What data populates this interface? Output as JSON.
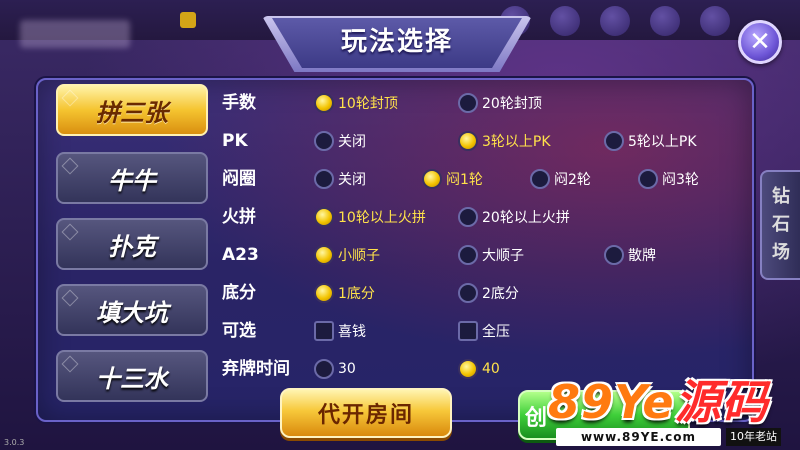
{
  "dialog": {
    "title": "玩法选择",
    "close_icon": "close-x-icon"
  },
  "version": "3.0.3",
  "tabs": [
    {
      "label": "拼三张",
      "active": true
    },
    {
      "label": "牛牛",
      "active": false
    },
    {
      "label": "扑克",
      "active": false
    },
    {
      "label": "填大坑",
      "active": false
    },
    {
      "label": "十三水",
      "active": false
    }
  ],
  "side_tab": {
    "label": "钻石场"
  },
  "rows": [
    {
      "label": "手数",
      "type": "radio",
      "options": [
        {
          "label": "10轮封顶",
          "selected": true
        },
        {
          "label": "20轮封顶",
          "selected": false
        }
      ]
    },
    {
      "label": "PK",
      "type": "radio",
      "options": [
        {
          "label": "关闭",
          "selected": false
        },
        {
          "label": "3轮以上PK",
          "selected": true
        },
        {
          "label": "5轮以上PK",
          "selected": false
        }
      ]
    },
    {
      "label": "闷圈",
      "type": "radio",
      "options": [
        {
          "label": "关闭",
          "selected": false
        },
        {
          "label": "闷1轮",
          "selected": true
        },
        {
          "label": "闷2轮",
          "selected": false
        },
        {
          "label": "闷3轮",
          "selected": false
        }
      ]
    },
    {
      "label": "火拼",
      "type": "radio",
      "options": [
        {
          "label": "10轮以上火拼",
          "selected": true
        },
        {
          "label": "20轮以上火拼",
          "selected": false
        }
      ]
    },
    {
      "label": "A23",
      "type": "radio",
      "options": [
        {
          "label": "小顺子",
          "selected": true
        },
        {
          "label": "大顺子",
          "selected": false
        },
        {
          "label": "散牌",
          "selected": false
        }
      ]
    },
    {
      "label": "底分",
      "type": "radio",
      "options": [
        {
          "label": "1底分",
          "selected": true
        },
        {
          "label": "2底分",
          "selected": false
        }
      ]
    },
    {
      "label": "可选",
      "type": "checkbox",
      "options": [
        {
          "label": "喜钱",
          "selected": false
        },
        {
          "label": "全压",
          "selected": false
        }
      ]
    },
    {
      "label": "弃牌时间",
      "type": "radio",
      "options": [
        {
          "label": "30",
          "selected": false
        },
        {
          "label": "40",
          "selected": true
        }
      ]
    }
  ],
  "buttons": {
    "create_room": "代开房间",
    "green_partial": "创"
  },
  "watermark": {
    "brand_latin": "89Ye",
    "brand_zh": "源码",
    "url": "www.89YE.com",
    "tag": "10年老站"
  },
  "colors": {
    "selected_text": "#ffe24a",
    "gold_button": "#f7c83a",
    "panel": "#2a2466"
  }
}
